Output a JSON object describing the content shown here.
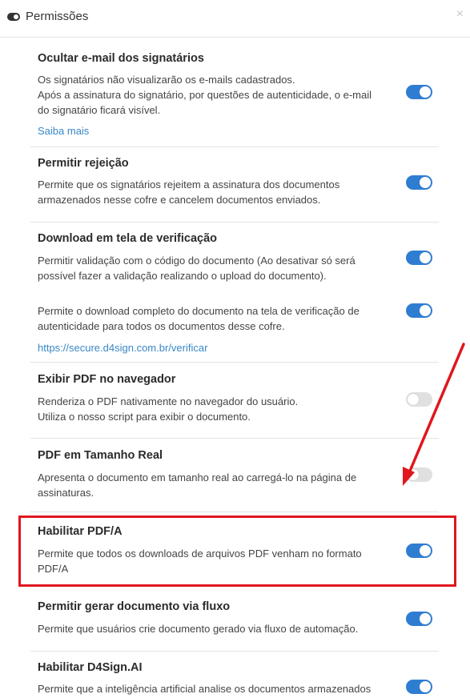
{
  "header": {
    "title": "Permissões",
    "close": "×"
  },
  "sections": [
    {
      "title": "Ocultar e-mail dos signatários",
      "desc1": "Os signatários não visualizarão os e-mails cadastrados.",
      "desc2": "Após a assinatura do signatário, por questões de autenticidade, o e-mail do signatário ficará visível.",
      "link": "Saiba mais",
      "enabled": true
    },
    {
      "title": "Permitir rejeição",
      "desc": "Permite que os signatários rejeitem a assinatura dos documentos armazenados nesse cofre e cancelem documentos enviados.",
      "enabled": true
    },
    {
      "title": "Download em tela de verificação",
      "desc": "Permitir validação com o código do documento (Ao desativar só será possível fazer a validação realizando o upload do documento).",
      "enabled": true,
      "sub": {
        "desc": "Permite o download completo do documento na tela de verificação de autenticidade para todos os documentos desse cofre.",
        "link": "https://secure.d4sign.com.br/verificar",
        "enabled": true
      }
    },
    {
      "title": "Exibir PDF no navegador",
      "desc1": "Renderiza o PDF nativamente no navegador do usuário.",
      "desc2": "Utiliza o nosso script para exibir o documento.",
      "enabled": false
    },
    {
      "title": "PDF em Tamanho Real",
      "desc": "Apresenta o documento em tamanho real ao carregá-lo na página de assinaturas.",
      "enabled": false
    },
    {
      "title": "Habilitar PDF/A",
      "desc": "Permite que todos os downloads de arquivos PDF venham no formato PDF/A",
      "enabled": true
    },
    {
      "title": "Permitir gerar documento via fluxo",
      "desc": "Permite que usuários crie documento gerado via fluxo de automação.",
      "enabled": true
    },
    {
      "title": "Habilitar D4Sign.AI",
      "desc": "Permite que a inteligência artificial analise os documentos armazenados",
      "enabled": true
    }
  ],
  "annotation_color": "#e0161e",
  "accent_color": "#2f7dd1"
}
